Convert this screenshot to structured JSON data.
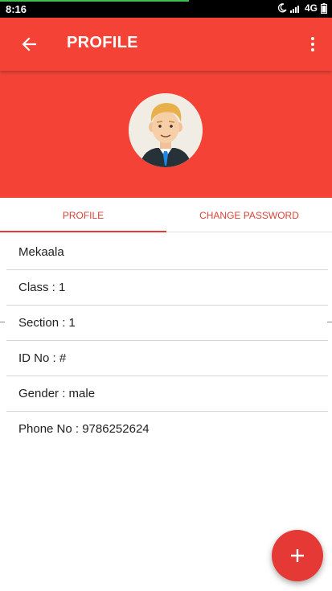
{
  "status_bar": {
    "time": "8:16",
    "network": "4G",
    "progress": 0.57,
    "icons": [
      "moon-icon",
      "signal-icon",
      "battery-icon"
    ]
  },
  "app_bar": {
    "title": "PROFILE",
    "color": "#f44336",
    "back_icon": "arrow-back-icon",
    "menu_icon": "more-vert-icon"
  },
  "avatar": {
    "icon": "user-avatar-icon"
  },
  "tabs": [
    {
      "label": "PROFILE",
      "selected": true
    },
    {
      "label": "CHANGE PASSWORD",
      "selected": false
    }
  ],
  "profile": {
    "fields": [
      {
        "text": "Mekaala"
      },
      {
        "text": "Class : 1"
      },
      {
        "text": "Section : 1"
      },
      {
        "text": "ID No : #"
      },
      {
        "text": "Gender : male"
      },
      {
        "text": "Phone No : 9786252624"
      }
    ]
  },
  "fab": {
    "icon": "plus-icon",
    "color": "#e53935"
  }
}
